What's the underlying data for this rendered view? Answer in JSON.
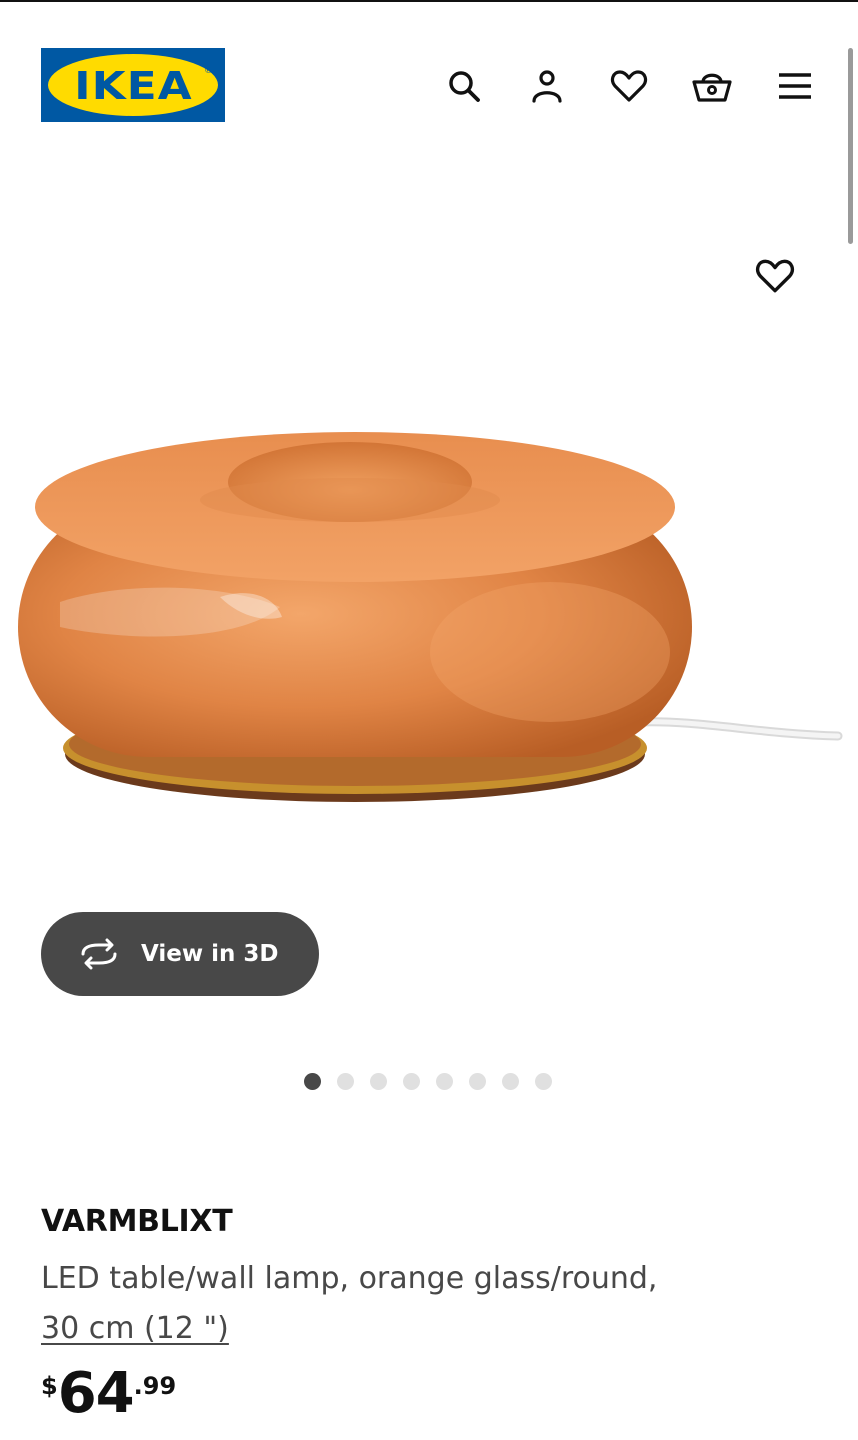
{
  "header": {
    "logo_text": "IKEA",
    "logo_mark": "®",
    "icons": [
      "search-icon",
      "account-icon",
      "heart-icon",
      "basket-icon",
      "menu-icon"
    ]
  },
  "gallery": {
    "favourite_icon": "heart-icon",
    "view_3d_label": "View in 3D",
    "dot_count": 8,
    "active_dot": 1
  },
  "product": {
    "name": "VARMBLIXT",
    "description": "LED table/wall lamp, orange glass/round,",
    "size": "30 cm (12 \")",
    "price": {
      "currency": "$",
      "integer": "64",
      "decimal": ".99"
    }
  },
  "colors": {
    "brand_blue": "#0058a3",
    "brand_yellow": "#ffdb00",
    "button_dark": "#484848"
  }
}
